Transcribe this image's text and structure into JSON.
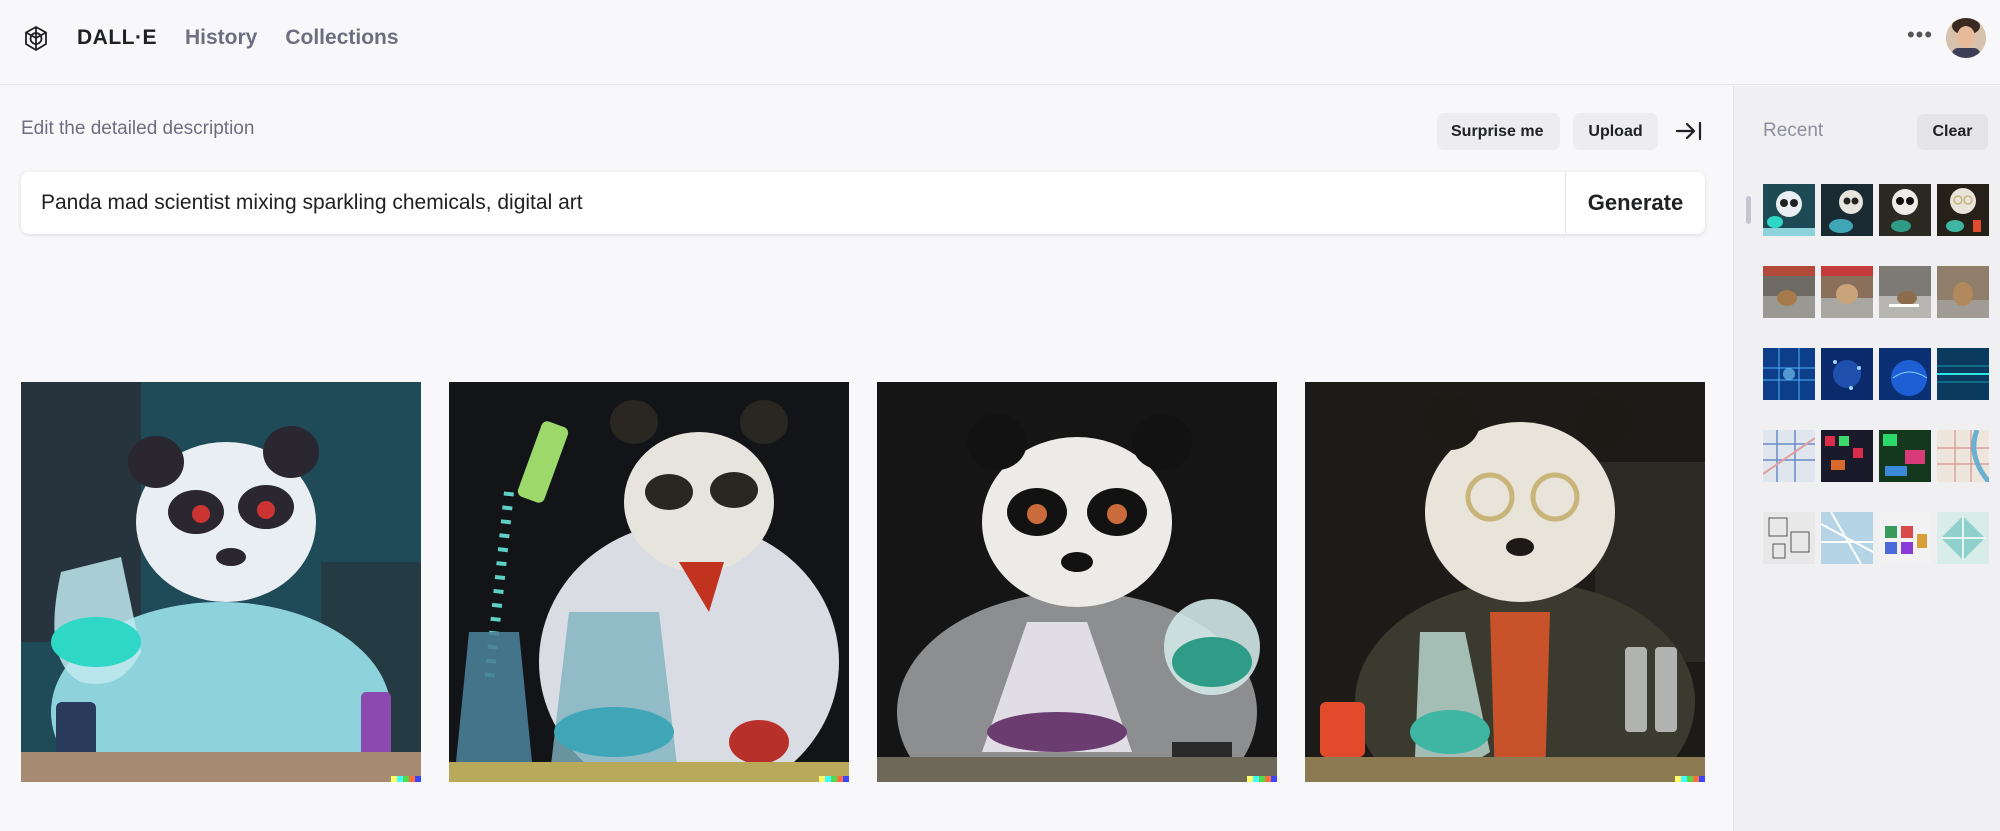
{
  "header": {
    "brand": "DALL·E",
    "nav": [
      "History",
      "Collections"
    ],
    "more_icon": "more-horizontal-icon",
    "logo_icon": "openai-logo-icon",
    "avatar_icon": "user-avatar"
  },
  "editor": {
    "label": "Edit the detailed description",
    "surprise_label": "Surprise me",
    "upload_label": "Upload",
    "collapse_icon": "arrow-right-bar-icon",
    "prompt_value": "Panda mad scientist mixing sparkling chemicals, digital art",
    "generate_label": "Generate"
  },
  "results": [
    {
      "name": "panda-scientist-teal-bg",
      "bg": "#1f4a57"
    },
    {
      "name": "panda-scientist-dark-splash",
      "bg": "#121418"
    },
    {
      "name": "panda-scientist-goggles",
      "bg": "#151515"
    },
    {
      "name": "panda-scientist-jacket",
      "bg": "#1c1b17"
    }
  ],
  "sidebar": {
    "recent_label": "Recent",
    "clear_label": "Clear",
    "rows": [
      {
        "theme": "panda-lab",
        "colors": [
          "#1d4a55",
          "#1a2a33",
          "#2a2a22",
          "#252018"
        ]
      },
      {
        "theme": "street-dog",
        "colors": [
          "#6e6a64",
          "#8a6f5a",
          "#7d7a76",
          "#8f7e6a"
        ]
      },
      {
        "theme": "digital-network",
        "colors": [
          "#0d3e8a",
          "#0a2a6b",
          "#0b2f73",
          "#0a3a5e"
        ]
      },
      {
        "theme": "maps",
        "colors": [
          "#dfe6ee",
          "#1a1a2a",
          "#14381d",
          "#eee6dc"
        ]
      },
      {
        "theme": "maps-2",
        "colors": [
          "#e8e8e8",
          "#b5d4e6",
          "#f2f2f2",
          "#d8ecea"
        ]
      }
    ]
  },
  "brand_colors": {
    "signature": [
      "#ffff66",
      "#42ffff",
      "#51da4c",
      "#ff6e3c",
      "#3c46ff"
    ]
  }
}
